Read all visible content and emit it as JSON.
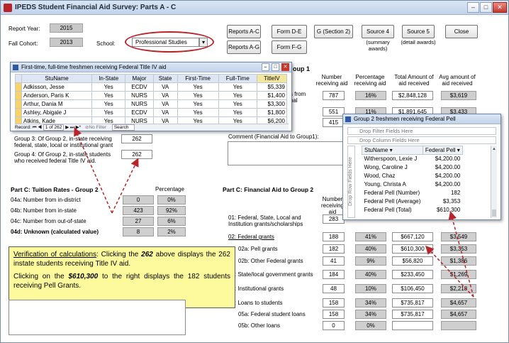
{
  "window": {
    "title": "IPEDS Student Financial Aid Survey:  Parts A - C"
  },
  "header": {
    "report_year_label": "Report Year:",
    "report_year": "2015",
    "fall_cohort_label": "Fall Cohort:",
    "fall_cohort": "2013",
    "school_label": "School:",
    "school": "Professional Studies"
  },
  "buttons": {
    "reports_ac": "Reports A-C",
    "reports_ag": "Reports A-G",
    "form_de": "Form D-E",
    "form_fg": "Form F-G",
    "g_section2": "G (Section 2)",
    "source4": "Source 4",
    "source4_sub": "(summary awards)",
    "source5": "Source 5",
    "source5_sub": "(detail awards)",
    "close": "Close"
  },
  "partB": {
    "group1_suffix": "oup 1",
    "rows_partial": [
      "s from",
      "nal"
    ],
    "col_headers": [
      "Number receiving aid",
      "Percentage receiving aid",
      "Total Amount of aid received",
      "Avg amount of aid received"
    ],
    "row1": [
      "787",
      "16%",
      "$2,848,128",
      "$3,619"
    ],
    "row2": [
      "551",
      "11%",
      "$1,891,645",
      "$3,433"
    ],
    "row3": [
      "415"
    ],
    "group3": "Group 3: Of Group 2, in-state receiving federal, state, local or institutional grant",
    "group3_val": "262",
    "group4": "Group 4: Of Group 2, in-state students who received federal Title IV aid.",
    "group4_val": "262",
    "comment_label": "Comment (Financial Aid to Group1):"
  },
  "freshmen_popup": {
    "title": "First-time, full-time freshmen receiving Federal Title IV aid",
    "columns": [
      "StuName",
      "In-State",
      "Major",
      "State",
      "First-Time",
      "Full-Time",
      "TitleIV"
    ],
    "rows": [
      [
        "Adkisson, Jesse",
        "Yes",
        "ECDV",
        "VA",
        "Yes",
        "Yes",
        "$5,339"
      ],
      [
        "Anderson, Paris K",
        "Yes",
        "NURS",
        "VA",
        "Yes",
        "Yes",
        "$1,400"
      ],
      [
        "Arthur, Dania M",
        "Yes",
        "NURS",
        "VA",
        "Yes",
        "Yes",
        "$3,300"
      ],
      [
        "Ashley, Abigale J",
        "Yes",
        "ECDV",
        "VA",
        "Yes",
        "Yes",
        "$1,800"
      ],
      [
        "Atkins, Kade",
        "Yes",
        "NURS",
        "VA",
        "Yes",
        "Yes",
        "$6,200"
      ]
    ],
    "nav": {
      "record_label": "Record:",
      "first": "⏮",
      "prev": "◀",
      "position": "1 of 262",
      "next": "▶",
      "last": "⏭",
      "new": "▶*",
      "no_filter": "No Filter",
      "search": "Search"
    }
  },
  "partC_tuition": {
    "title": "Part C:  Tuition Rates - Group 2",
    "pct_header": "Percentage",
    "rows": [
      {
        "label": "04a: Number from in-district",
        "num": "0",
        "pct": "0%"
      },
      {
        "label": "04b: Number from in-state",
        "num": "423",
        "pct": "92%"
      },
      {
        "label": "04c: Number from out-of-state",
        "num": "27",
        "pct": "6%"
      },
      {
        "label": "04d: Unknown (calculated value)",
        "num": "8",
        "pct": "2%"
      }
    ]
  },
  "partC_aid": {
    "title": "Part C:  Financial Aid to Group 2",
    "col_header_partial": "Number receiving aid",
    "row01": {
      "label": "01: Federal, State, Local and Institution grants/scholarships",
      "num": "283"
    },
    "rows": [
      {
        "label": "02: Federal grants",
        "num": "188",
        "pct": "41%",
        "total": "$667,120",
        "avg": "$3,549"
      },
      {
        "label": "02a: Pell grants",
        "num": "182",
        "pct": "40%",
        "total": "$610,300",
        "avg": "$3,353"
      },
      {
        "label": "02b: Other Federal grants",
        "num": "41",
        "pct": "9%",
        "total": "$56,820",
        "avg": "$1,386"
      },
      {
        "label": "03: State/local government grants",
        "num": "184",
        "pct": "40%",
        "total": "$233,450",
        "avg": "$1,269"
      },
      {
        "label": "04: Institutional grants",
        "num": "48",
        "pct": "10%",
        "total": "$106,450",
        "avg": "$2,218"
      },
      {
        "label": "05: Loans to students",
        "num": "158",
        "pct": "34%",
        "total": "$735,817",
        "avg": "$4,657"
      },
      {
        "label": "05a: Federal student loans",
        "num": "158",
        "pct": "34%",
        "total": "$735,817",
        "avg": "$4,657"
      },
      {
        "label": "05b: Other loans",
        "num": "0",
        "pct": "0%",
        "total": "",
        "avg": ""
      }
    ]
  },
  "pell_popup": {
    "title": "Group 2 freshmen receiving Federal Pell",
    "drop_filter": "Drop Filter Fields Here",
    "drop_column": "Drop Column Fields Here",
    "drop_row": "Drop Row Fields Here",
    "col_stuname": "StuName",
    "col_pell": "Federal Pell",
    "rows": [
      [
        "Witherspoon, Lexie J",
        "$4,200.00"
      ],
      [
        "Wong, Caroline J",
        "$4,200.00"
      ],
      [
        "Wood, Chaz",
        "$4,200.00"
      ],
      [
        "Young, Christa A",
        "$4,200.00"
      ]
    ],
    "totals": [
      [
        "Federal Pell (Number)",
        "182"
      ],
      [
        "Federal Pell (Average)",
        "$3,353"
      ],
      [
        "Federal Pell (Total)",
        "$610,300"
      ]
    ]
  },
  "callout": {
    "line1_link": "Verification of calculations",
    "line1_a": ": Clicking the ",
    "line1_num": "262",
    "line1_b": " above displays the 262 instate students receiving Title IV aid.",
    "line2_a": "Clicking on the ",
    "line2_num": "$610,300",
    "line2_b": " to the right displays the 182 students receiving Pell Grants."
  },
  "colors": {
    "accent": "#b8242a",
    "callout_bg": "#fdfa9e",
    "arrow": "#b8242a"
  }
}
